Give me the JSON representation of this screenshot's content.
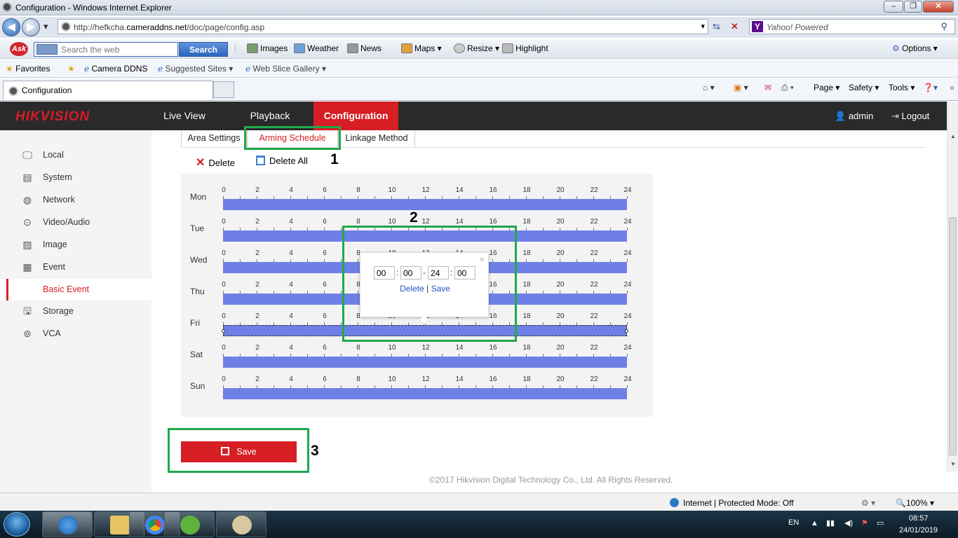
{
  "window": {
    "title": "Configuration - Windows Internet Explorer"
  },
  "address": {
    "url_prefix": "http://hefkcha.",
    "url_domain": "cameraddns.net",
    "url_path": "/doc/page/config.asp",
    "search_text": "Yahoo! Powered"
  },
  "askbar": {
    "placeholder": "Search the web",
    "search_button": "Search",
    "items": [
      "Images",
      "Weather",
      "News",
      "Maps",
      "Resize",
      "Highlight"
    ],
    "options": "Options"
  },
  "favbar": {
    "favorites": "Favorites",
    "items": [
      "Camera DDNS",
      "Suggested Sites",
      "Web Slice Gallery"
    ]
  },
  "tabs": {
    "active": "Configuration"
  },
  "commandbar": {
    "page": "Page",
    "safety": "Safety",
    "tools": "Tools"
  },
  "hik": {
    "logo": "HIKVISION",
    "nav": [
      "Live View",
      "Playback",
      "Configuration"
    ],
    "user": "admin",
    "logout": "Logout"
  },
  "sidebar": {
    "items": [
      "Local",
      "System",
      "Network",
      "Video/Audio",
      "Image",
      "Event",
      "Basic Event",
      "Storage",
      "VCA"
    ],
    "selected": "Basic Event"
  },
  "subtabs": [
    "Area Settings",
    "Arming Schedule",
    "Linkage Method"
  ],
  "actions": {
    "delete": "Delete",
    "delete_all": "Delete All"
  },
  "schedule": {
    "days": [
      "Mon",
      "Tue",
      "Wed",
      "Thu",
      "Fri",
      "Sat",
      "Sun"
    ],
    "hour_labels": [
      "0",
      "2",
      "4",
      "6",
      "8",
      "10",
      "12",
      "14",
      "16",
      "18",
      "20",
      "22",
      "24"
    ],
    "segments": [
      {
        "day": "Mon",
        "start": "00:00",
        "end": "24:00"
      },
      {
        "day": "Tue",
        "start": "00:00",
        "end": "24:00"
      },
      {
        "day": "Wed",
        "start": "00:00",
        "end": "24:00"
      },
      {
        "day": "Thu",
        "start": "00:00",
        "end": "24:00"
      },
      {
        "day": "Fri",
        "start": "00:00",
        "end": "24:00",
        "selected": true
      },
      {
        "day": "Sat",
        "start": "00:00",
        "end": "24:00"
      },
      {
        "day": "Sun",
        "start": "00:00",
        "end": "24:00"
      }
    ],
    "track_color": "#6e80e6"
  },
  "popup": {
    "start_h": "00",
    "start_m": "00",
    "end_h": "24",
    "end_m": "00",
    "colon": ":",
    "dash": "-",
    "delete": "Delete",
    "pipe": "|",
    "save": "Save",
    "close": "×"
  },
  "save_button": "Save",
  "annotations": [
    "1",
    "2",
    "3"
  ],
  "copyright": "©2017 Hikvision Digital Technology Co., Ltd. All Rights Reserved.",
  "status": {
    "zone": "Internet | Protected Mode: Off",
    "zoom": "100%"
  },
  "taskbar": {
    "lang": "EN",
    "time": "08:57",
    "date": "24/01/2019"
  },
  "colors": {
    "brand_red": "#d61e24",
    "highlight_green": "#20a94b",
    "header_dark": "#2a2a2a"
  }
}
